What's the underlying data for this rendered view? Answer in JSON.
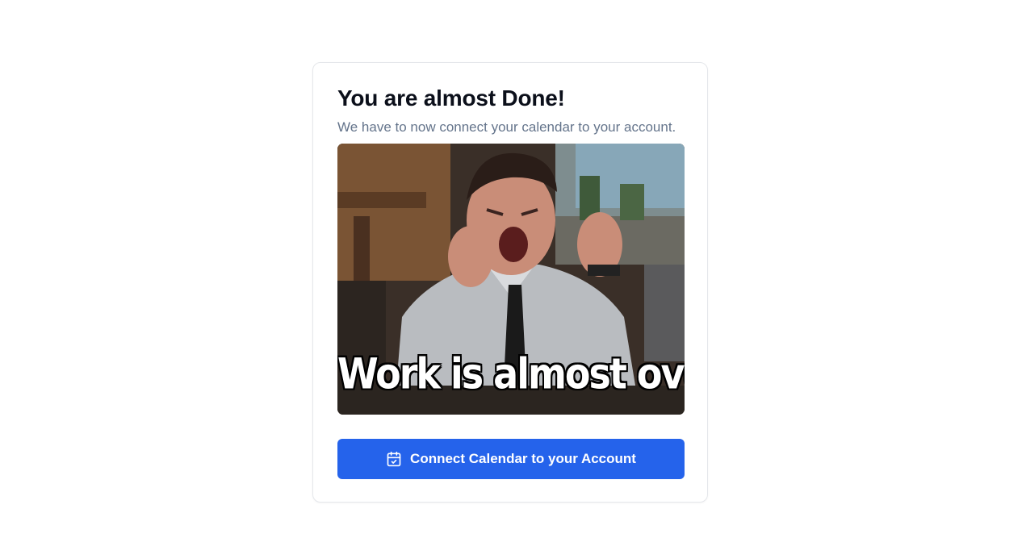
{
  "card": {
    "title": "You are almost Done!",
    "subtitle": "We have to now connect your calendar to your account.",
    "gif": {
      "caption": "Work is almost over"
    },
    "connect_button": {
      "label": "Connect Calendar to your Account",
      "icon": "calendar-check-icon"
    }
  },
  "colors": {
    "accent": "#2563eb",
    "title": "#0b0f1a",
    "subtitle": "#64748b",
    "card_border": "#e5e7eb"
  }
}
